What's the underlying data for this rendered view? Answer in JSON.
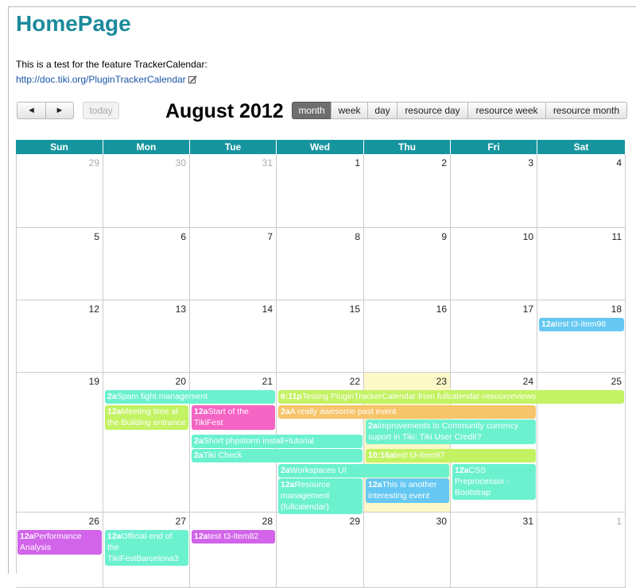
{
  "page": {
    "title": "HomePage",
    "description": "This is a test for the feature TrackerCalendar:",
    "link": "http://doc.tiki.org/PluginTrackerCalendar"
  },
  "toolbar": {
    "prev": "◄",
    "next": "►",
    "today": "today",
    "month_title": "August 2012",
    "views": [
      "month",
      "week",
      "day",
      "resource day",
      "resource week",
      "resource month"
    ]
  },
  "calendar": {
    "weekdays": [
      "Sun",
      "Mon",
      "Tue",
      "Wed",
      "Thu",
      "Fri",
      "Sat"
    ],
    "weeks": [
      [
        {
          "d": "29",
          "o": true
        },
        {
          "d": "30",
          "o": true
        },
        {
          "d": "31",
          "o": true
        },
        {
          "d": "1"
        },
        {
          "d": "2"
        },
        {
          "d": "3"
        },
        {
          "d": "4"
        }
      ],
      [
        {
          "d": "5"
        },
        {
          "d": "6"
        },
        {
          "d": "7"
        },
        {
          "d": "8"
        },
        {
          "d": "9"
        },
        {
          "d": "10"
        },
        {
          "d": "11"
        }
      ],
      [
        {
          "d": "12"
        },
        {
          "d": "13"
        },
        {
          "d": "14"
        },
        {
          "d": "15"
        },
        {
          "d": "16"
        },
        {
          "d": "17"
        },
        {
          "d": "18"
        }
      ],
      [
        {
          "d": "19"
        },
        {
          "d": "20"
        },
        {
          "d": "21"
        },
        {
          "d": "22"
        },
        {
          "d": "23",
          "today": true
        },
        {
          "d": "24"
        },
        {
          "d": "25"
        }
      ],
      [
        {
          "d": "26"
        },
        {
          "d": "27"
        },
        {
          "d": "28"
        },
        {
          "d": "29"
        },
        {
          "d": "30"
        },
        {
          "d": "31"
        },
        {
          "d": "1",
          "o": true
        }
      ]
    ],
    "events": [
      {
        "time": "12a",
        "title": "test t3-item98",
        "color": "#66c8f2",
        "week": 2,
        "col": 6,
        "span": 1,
        "slot": 0,
        "lines": 1
      },
      {
        "time": "2a",
        "title": "Spam fight management",
        "color": "#6cf1cf",
        "week": 3,
        "col": 1,
        "span": 2,
        "slot": 0,
        "lines": 1
      },
      {
        "time": "6:11p",
        "title": "Testing PluginTrackerCalendar from fullcalendar-resourceviews",
        "color": "#c3f263",
        "week": 3,
        "col": 3,
        "span": 4,
        "slot": 0,
        "lines": 1
      },
      {
        "time": "12a",
        "title": "Meeting time at the Building entrance",
        "color": "#c3f263",
        "week": 3,
        "col": 1,
        "span": 1,
        "slot": 1,
        "lines": 2
      },
      {
        "time": "12a",
        "title": "Start of the TikiFest",
        "color": "#f565c4",
        "week": 3,
        "col": 2,
        "span": 1,
        "slot": 1,
        "lines": 2
      },
      {
        "time": "2a",
        "title": "A really awesome past event",
        "color": "#f6c46a",
        "week": 3,
        "col": 3,
        "span": 3,
        "slot": 1,
        "lines": 1
      },
      {
        "time": "2a",
        "title": "Improvements to Community currency suport in Tiki: Tiki User Credit?",
        "color": "#6cf1cf",
        "week": 3,
        "col": 4,
        "span": 2,
        "slot": 2,
        "lines": 2
      },
      {
        "time": "2a",
        "title": "Short phpstorm install+tutorial",
        "color": "#6cf1cf",
        "week": 3,
        "col": 2,
        "span": 2,
        "slot": 3,
        "lines": 1
      },
      {
        "time": "2a",
        "title": "Tiki Check",
        "color": "#6cf1cf",
        "week": 3,
        "col": 2,
        "span": 2,
        "slot": 4,
        "lines": 1
      },
      {
        "time": "10:16a",
        "title": "test t3-item97",
        "color": "#c3f263",
        "week": 3,
        "col": 4,
        "span": 2,
        "slot": 4,
        "lines": 1
      },
      {
        "time": "2a",
        "title": "Workspaces UI",
        "color": "#6cf1cf",
        "week": 3,
        "col": 3,
        "span": 2,
        "slot": 5,
        "lines": 1
      },
      {
        "time": "12a",
        "title": "CSS Preprocessor - Bootstrap",
        "color": "#6cf1cf",
        "week": 3,
        "col": 5,
        "span": 1,
        "slot": 5,
        "lines": 3
      },
      {
        "time": "12a",
        "title": "Resource management (fullcalendar)",
        "color": "#6cf1cf",
        "week": 3,
        "col": 3,
        "span": 1,
        "slot": 6,
        "lines": 3
      },
      {
        "time": "12a",
        "title": "This is another interesting event",
        "color": "#66c8f2",
        "week": 3,
        "col": 4,
        "span": 1,
        "slot": 6,
        "lines": 2
      },
      {
        "time": "12a",
        "title": "Performance Analysis",
        "color": "#d264ea",
        "week": 4,
        "col": 0,
        "span": 1,
        "slot": 0,
        "lines": 2
      },
      {
        "time": "12a",
        "title": "Official end of the TikiFestBarcelona3",
        "color": "#6cf1cf",
        "week": 4,
        "col": 1,
        "span": 1,
        "slot": 0,
        "lines": 3
      },
      {
        "time": "12a",
        "title": "test t3-item82",
        "color": "#d264ea",
        "week": 4,
        "col": 2,
        "span": 1,
        "slot": 0,
        "lines": 1
      }
    ]
  }
}
